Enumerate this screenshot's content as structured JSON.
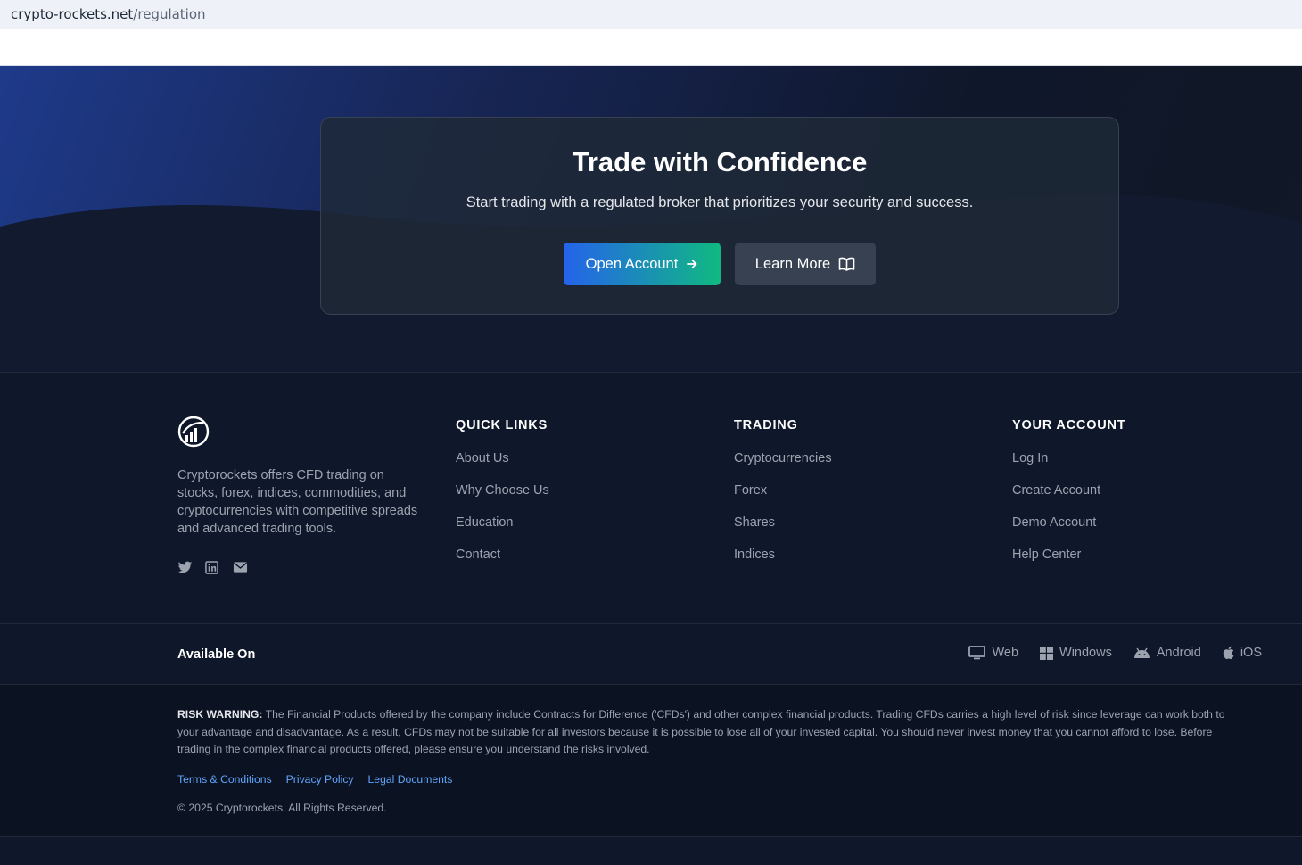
{
  "browser": {
    "url_domain": "crypto-rockets.net",
    "url_path": "/regulation"
  },
  "cta": {
    "title": "Trade with Confidence",
    "subtitle": "Start trading with a regulated broker that prioritizes your security and success.",
    "open_account": "Open Account",
    "learn_more": "Learn More"
  },
  "footer": {
    "about": "Cryptorockets offers CFD trading on stocks, forex, indices, commodities, and cryptocurrencies with competitive spreads and advanced trading tools.",
    "socials": [
      "twitter-icon",
      "linkedin-icon",
      "mail-icon"
    ],
    "columns": [
      {
        "title": "QUICK LINKS",
        "links": [
          "About Us",
          "Why Choose Us",
          "Education",
          "Contact"
        ]
      },
      {
        "title": "TRADING",
        "links": [
          "Cryptocurrencies",
          "Forex",
          "Shares",
          "Indices"
        ]
      },
      {
        "title": "YOUR ACCOUNT",
        "links": [
          "Log In",
          "Create Account",
          "Demo Account",
          "Help Center"
        ]
      }
    ]
  },
  "available": {
    "label": "Available On",
    "platforms": [
      {
        "name": "Web",
        "icon": "monitor-icon"
      },
      {
        "name": "Windows",
        "icon": "windows-icon"
      },
      {
        "name": "Android",
        "icon": "android-icon"
      },
      {
        "name": "iOS",
        "icon": "apple-icon"
      }
    ]
  },
  "legal": {
    "risk_label": "RISK WARNING:",
    "risk_text": " The Financial Products offered by the company include Contracts for Difference ('CFDs') and other complex financial products. Trading CFDs carries a high level of risk since leverage can work both to your advantage and disadvantage. As a result, CFDs may not be suitable for all investors because it is possible to lose all of your invested capital. You should never invest money that you cannot afford to lose. Before trading in the complex financial products offered, please ensure you understand the risks involved.",
    "links": [
      "Terms & Conditions",
      "Privacy Policy",
      "Legal Documents"
    ],
    "copyright": "© 2025 Cryptorockets. All Rights Reserved."
  },
  "colors": {
    "accent_blue": "#2563eb",
    "accent_green": "#10b981",
    "link": "#60a5fa",
    "background": "#0f172a"
  }
}
